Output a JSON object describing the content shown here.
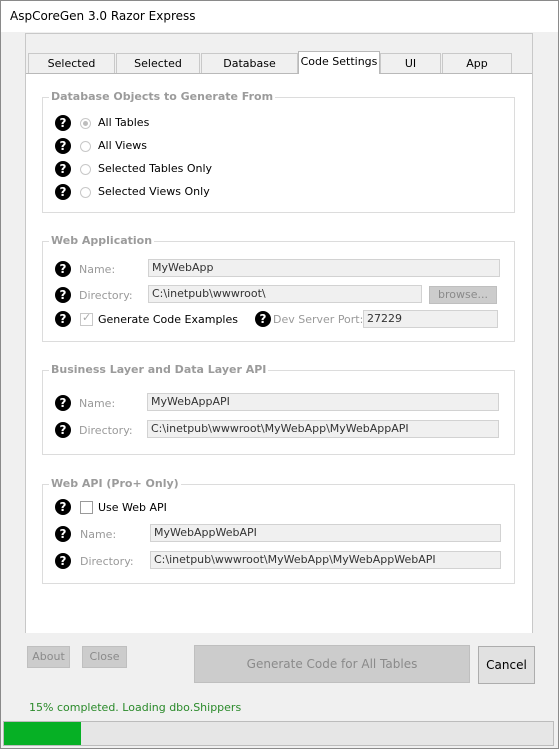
{
  "window": {
    "title": "AspCoreGen 3.0 Razor Express"
  },
  "tabs": [
    {
      "label": "Selected Tables"
    },
    {
      "label": "Selected Views"
    },
    {
      "label": "Database Settings"
    },
    {
      "label": "Code Settings"
    },
    {
      "label": "UI Settings"
    },
    {
      "label": "App Settings"
    }
  ],
  "active_tab": "Code Settings",
  "db_objects": {
    "title": "Database Objects to Generate From",
    "options": [
      {
        "label": "All Tables",
        "selected": true
      },
      {
        "label": "All Views",
        "selected": false
      },
      {
        "label": "Selected Tables Only",
        "selected": false
      },
      {
        "label": "Selected Views Only",
        "selected": false
      }
    ]
  },
  "web_app": {
    "title": "Web Application",
    "name_label": "Name:",
    "name_value": "MyWebApp",
    "dir_label": "Directory:",
    "dir_value": "C:\\inetpub\\wwwroot\\",
    "browse_label": "browse...",
    "gen_examples_label": "Generate Code Examples",
    "gen_examples_checked": true,
    "port_label": "Dev Server Port:",
    "port_value": "27229"
  },
  "business_layer": {
    "title": "Business Layer and Data Layer API",
    "name_label": "Name:",
    "name_value": "MyWebAppAPI",
    "dir_label": "Directory:",
    "dir_value": "C:\\inetpub\\wwwroot\\MyWebApp\\MyWebAppAPI"
  },
  "web_api": {
    "title": "Web API (Pro+ Only)",
    "use_label": "Use Web API",
    "use_checked": false,
    "name_label": "Name:",
    "name_value": "MyWebAppWebAPI",
    "dir_label": "Directory:",
    "dir_value": "C:\\inetpub\\wwwroot\\MyWebApp\\MyWebAppWebAPI"
  },
  "buttons": {
    "about": "About",
    "close": "Close",
    "generate": "Generate Code for All Tables",
    "cancel": "Cancel"
  },
  "status": {
    "text": "15% completed.  Loading dbo.Shippers"
  },
  "progress": {
    "fraction": 0.14,
    "color": "#06b025"
  },
  "icons": {
    "help": "question-circle-icon"
  }
}
